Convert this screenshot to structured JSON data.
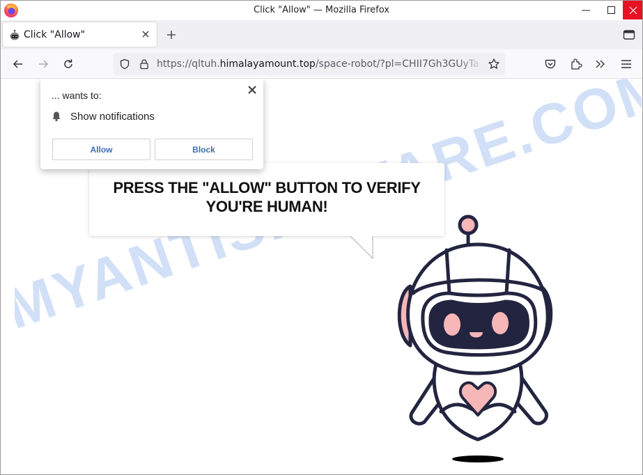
{
  "window": {
    "title": "Click \"Allow\" — Mozilla Firefox",
    "controls": {
      "minimize": "minimize",
      "maximize": "maximize",
      "close": "close"
    }
  },
  "tabs": [
    {
      "title": "Click \"Allow\"",
      "favicon": "robot-icon",
      "active": true
    }
  ],
  "navbar": {
    "url_prefix": "https://qltuh.",
    "url_host": "himalayamount.top",
    "url_path": "/space-robot/?pl=CHII7Gh3GUyTa",
    "icons": [
      "back-icon",
      "forward-icon",
      "reload-icon",
      "shield-icon",
      "lock-icon",
      "star-icon",
      "pocket-icon",
      "extensions-icon",
      "overflow-icon",
      "menu-icon"
    ]
  },
  "permission_popup": {
    "wants_to": "... wants to:",
    "permission": "Show notifications",
    "allow_label": "Allow",
    "block_label": "Block"
  },
  "page": {
    "headline_line1": "PRESS THE \"ALLOW\" BUTTON TO VERIFY",
    "headline_line2": "YOU'RE HUMAN!",
    "watermark": "MYANTISPYWARE.COM"
  },
  "colors": {
    "robot_outline": "#232540",
    "robot_pink": "#f7b6b7",
    "close_red": "#e81123",
    "watermark_blue": "#c9dbf6",
    "button_text": "#3b6eb5"
  }
}
